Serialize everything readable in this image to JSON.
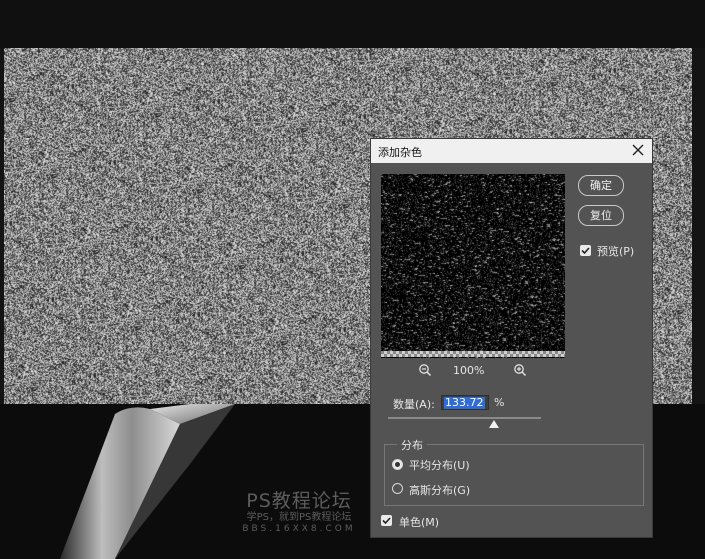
{
  "dialog": {
    "title": "添加杂色",
    "ok_label": "确定",
    "reset_label": "复位",
    "preview_label": "预览(P)",
    "preview_checked": true,
    "zoom_level": "100%",
    "amount_label": "数量(A):",
    "amount_value": "133.72",
    "amount_unit": "%",
    "distribution_title": "分布",
    "uniform_label": "平均分布(U)",
    "gaussian_label": "高斯分布(G)",
    "selected_distribution": "uniform",
    "monochromatic_label": "单色(M)",
    "monochromatic_checked": true
  },
  "watermark": {
    "title": "PS教程论坛",
    "subtitle": "学PS，就到PS教程论坛",
    "url": "BBS.16XX8.COM"
  }
}
